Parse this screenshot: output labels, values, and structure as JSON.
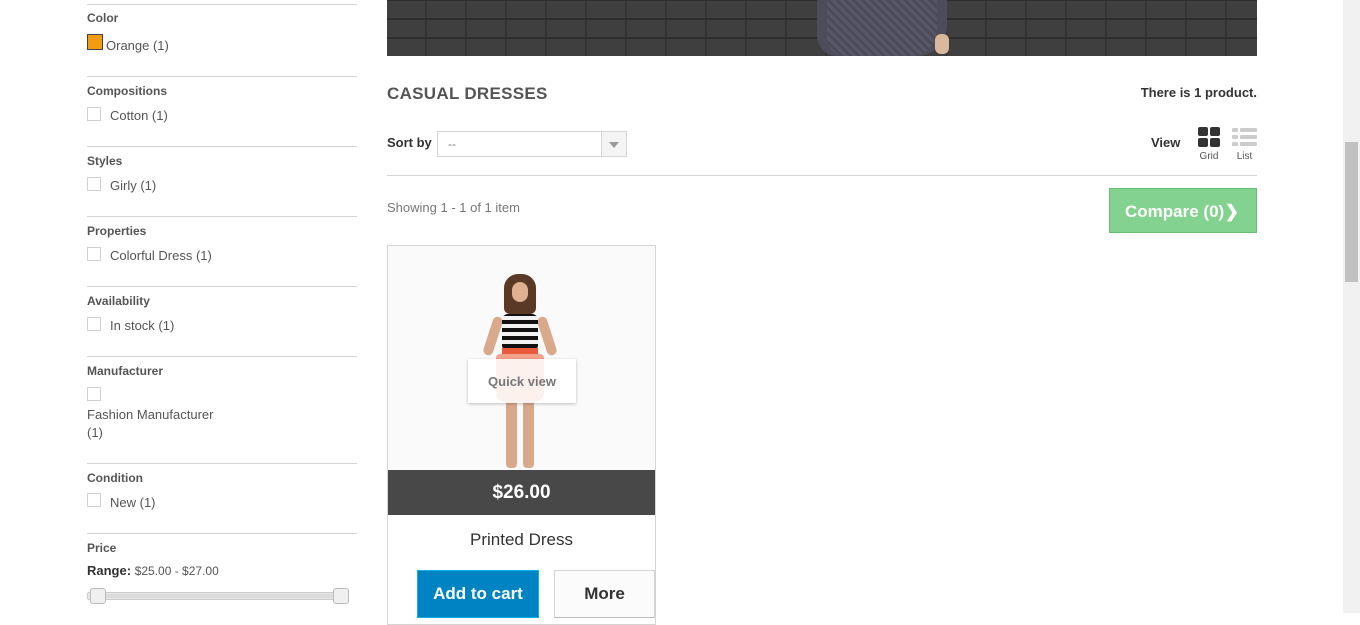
{
  "sidebar": {
    "color": {
      "title": "Color",
      "options": [
        {
          "label": "Orange (1)",
          "swatch": "#f39c11"
        }
      ]
    },
    "compositions": {
      "title": "Compositions",
      "options": [
        {
          "label": "Cotton (1)"
        }
      ]
    },
    "styles": {
      "title": "Styles",
      "options": [
        {
          "label": "Girly (1)"
        }
      ]
    },
    "properties": {
      "title": "Properties",
      "options": [
        {
          "label": "Colorful Dress (1)"
        }
      ]
    },
    "availability": {
      "title": "Availability",
      "options": [
        {
          "label": "In stock (1)"
        }
      ]
    },
    "manufacturer": {
      "title": "Manufacturer",
      "options": [
        {
          "label_line1": "Fashion Manufacturer",
          "label_line2": "(1)"
        }
      ]
    },
    "condition": {
      "title": "Condition",
      "options": [
        {
          "label": "New (1)"
        }
      ]
    },
    "price": {
      "title": "Price",
      "range_label": "Range:",
      "range_value": "$25.00 - $27.00",
      "min": 25,
      "max": 27,
      "selected_min": 25,
      "selected_max": 27
    }
  },
  "main": {
    "category_title": "CASUAL DRESSES",
    "product_count_text": "There is 1 product.",
    "sort": {
      "label": "Sort by",
      "value": "--"
    },
    "view": {
      "label": "View",
      "grid_label": "Grid",
      "list_label": "List",
      "active": "grid"
    },
    "showing_text": "Showing 1 - 1 of 1 item",
    "compare": {
      "label": "Compare (0)",
      "color": "#83d28f"
    },
    "products": [
      {
        "name": "Printed Dress",
        "price": "$26.00",
        "quick_view": "Quick view",
        "add_to_cart": "Add to cart",
        "more": "More"
      }
    ]
  },
  "colors": {
    "accent_blue": "#0083c2",
    "price_bar": "#484848",
    "compare_green": "#83d28f"
  }
}
